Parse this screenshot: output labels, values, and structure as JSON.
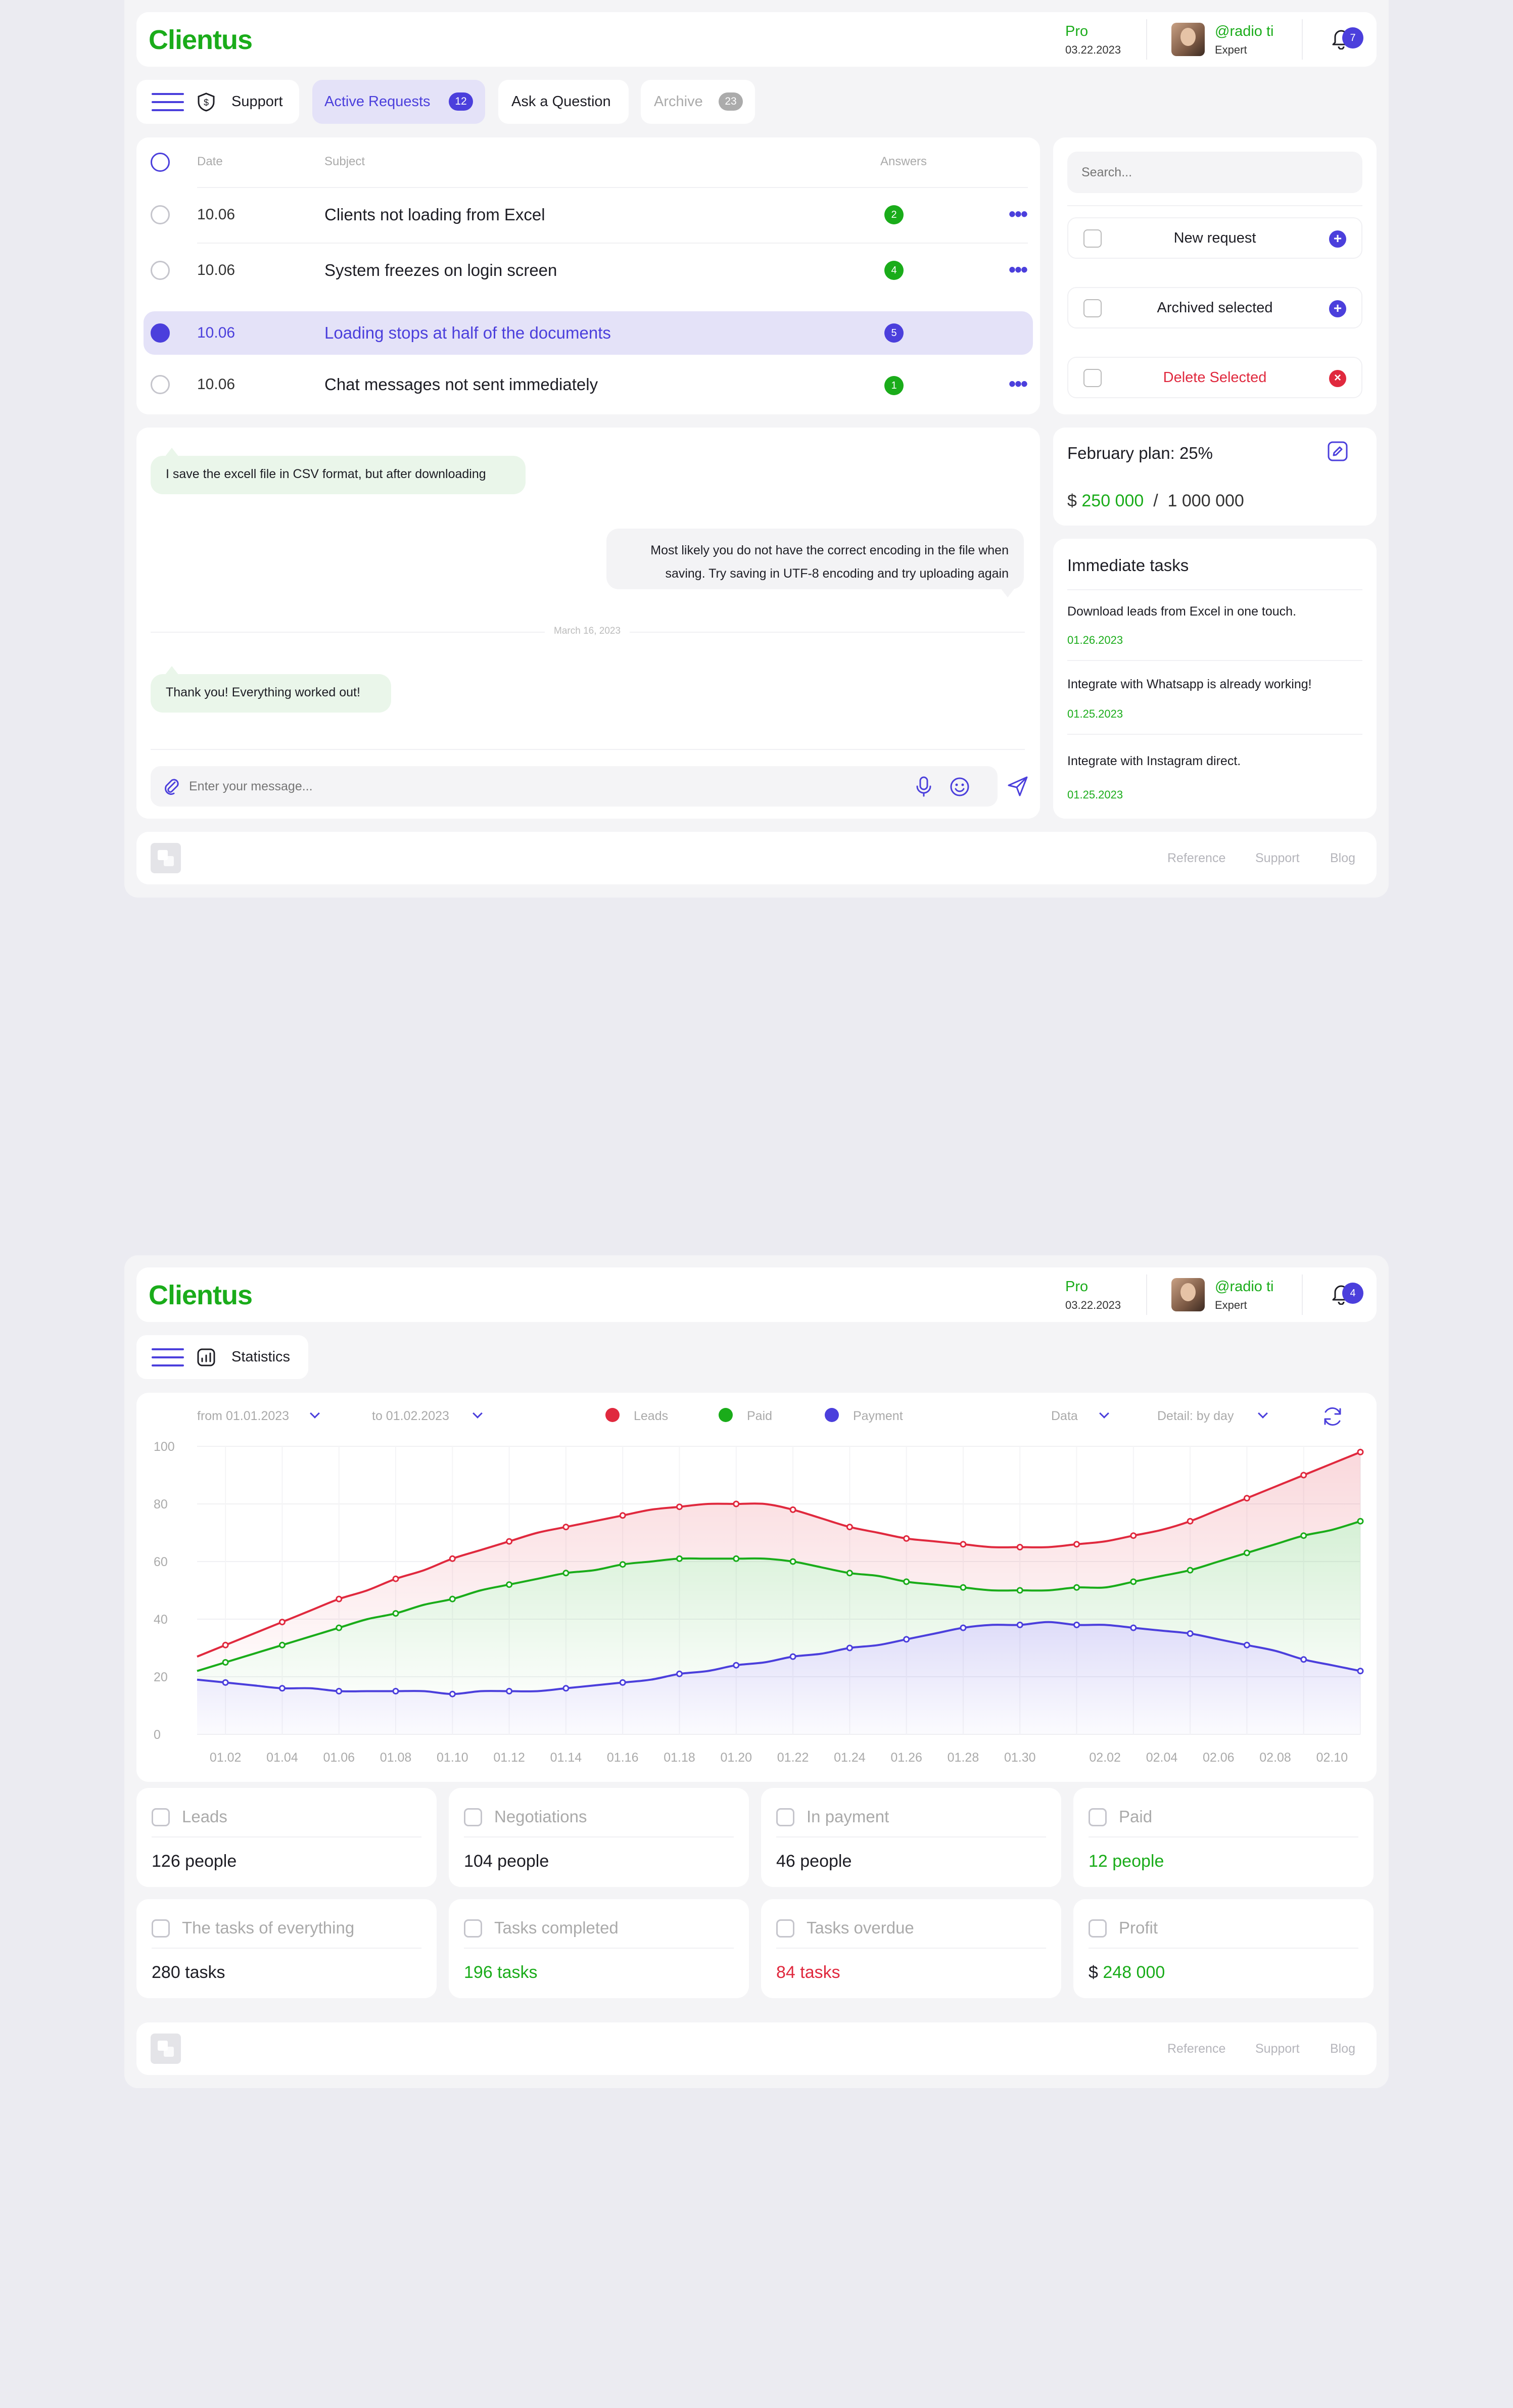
{
  "brand": {
    "name": "Clientus"
  },
  "header": {
    "plan": "Pro",
    "date": "03.22.2023",
    "username": "@radio ti",
    "role": "Expert",
    "notifications_screen1": "7",
    "notifications_screen2": "4"
  },
  "tabs": {
    "support": "Support",
    "active_requests": "Active Requests",
    "active_requests_count": "12",
    "ask_question": "Ask a Question",
    "archive": "Archive",
    "archive_count": "23",
    "statistics": "Statistics"
  },
  "requests": {
    "columns": {
      "date": "Date",
      "subject": "Subject",
      "answers": "Answers"
    },
    "rows": [
      {
        "date": "10.06",
        "subject": "Clients not loading from Excel",
        "answers": "2",
        "color": "#1aac1a"
      },
      {
        "date": "10.06",
        "subject": "System freezes on login screen",
        "answers": "4",
        "color": "#1aac1a"
      },
      {
        "date": "10.06",
        "subject": "Loading stops at half of the documents",
        "answers": "5",
        "color": "#4b3fdc"
      },
      {
        "date": "10.06",
        "subject": "Chat messages not sent immediately",
        "answers": "1",
        "color": "#1aac1a"
      }
    ]
  },
  "chat": {
    "msg1": "I save the excell file in CSV format, but after downloading",
    "msg2_line1": "Most likely you do not have the correct encoding in the file when",
    "msg2_line2": "saving. Try saving in UTF-8 encoding and try uploading again",
    "date_divider": "March 16, 2023",
    "msg3": "Thank you! Everything worked out!",
    "input_placeholder": "Enter your message..."
  },
  "sidebar": {
    "search_placeholder": "Search...",
    "new_request": "New request",
    "archived_selected": "Archived selected",
    "delete_selected": "Delete Selected"
  },
  "plan": {
    "title": "February plan: 25%",
    "currency": "$",
    "current": "250 000",
    "divider": "/",
    "target": "1 000 000",
    "fraction": 0.25
  },
  "tasks": {
    "title": "Immediate tasks",
    "items": [
      {
        "title": "Download leads from Excel in one touch.",
        "date": "01.26.2023"
      },
      {
        "title": "Integrate with Whatsapp is already working!",
        "date": "01.25.2023"
      },
      {
        "title": "Integrate with Instagram direct.",
        "date": "01.25.2023"
      }
    ]
  },
  "footer": {
    "reference": "Reference",
    "support": "Support",
    "blog": "Blog"
  },
  "filters": {
    "from": "from 01.01.2023",
    "to": "to 01.02.2023",
    "data": "Data",
    "detail": "Detail: by day"
  },
  "chart_data": {
    "type": "area",
    "ylim": [
      0,
      100
    ],
    "yticks": [
      0,
      20,
      40,
      60,
      80,
      100
    ],
    "x": [
      "01.01",
      "01.02",
      "01.03",
      "01.04",
      "01.05",
      "01.06",
      "01.07",
      "01.08",
      "01.09",
      "01.10",
      "01.11",
      "01.12",
      "01.13",
      "01.14",
      "01.15",
      "01.16",
      "01.17",
      "01.18",
      "01.19",
      "01.20",
      "01.21",
      "01.22",
      "01.23",
      "01.24",
      "01.25",
      "01.26",
      "01.27",
      "01.28",
      "01.29",
      "01.30",
      "01.31",
      "02.01",
      "02.02",
      "02.03",
      "02.04",
      "02.05",
      "02.06",
      "02.07",
      "02.08",
      "02.09",
      "02.10",
      "02.11"
    ],
    "xtick_labels": [
      "01.02",
      "01.04",
      "01.06",
      "01.08",
      "01.10",
      "01.12",
      "01.14",
      "01.16",
      "01.18",
      "01.20",
      "01.22",
      "01.24",
      "01.26",
      "01.28",
      "01.30",
      "02.02",
      "02.04",
      "02.06",
      "02.08",
      "02.10"
    ],
    "legend_position": "top-center",
    "grid": true,
    "series": [
      {
        "name": "Leads",
        "color": "#e0293e",
        "values": [
          27,
          31,
          35,
          39,
          43,
          47,
          50,
          54,
          57,
          61,
          64,
          67,
          70,
          72,
          74,
          76,
          78,
          79,
          80,
          80,
          80,
          78,
          75,
          72,
          70,
          68,
          67,
          66,
          65,
          65,
          65,
          66,
          67,
          69,
          71,
          74,
          78,
          82,
          86,
          90,
          94,
          98
        ]
      },
      {
        "name": "Paid",
        "color": "#1aac1a",
        "values": [
          22,
          25,
          28,
          31,
          34,
          37,
          40,
          42,
          45,
          47,
          50,
          52,
          54,
          56,
          57,
          59,
          60,
          61,
          61,
          61,
          61,
          60,
          58,
          56,
          55,
          53,
          52,
          51,
          50,
          50,
          50,
          51,
          51,
          53,
          55,
          57,
          60,
          63,
          66,
          69,
          71,
          74
        ]
      },
      {
        "name": "Payment",
        "color": "#4b3fdc",
        "values": [
          19,
          18,
          17,
          16,
          16,
          15,
          15,
          15,
          15,
          14,
          15,
          15,
          15,
          16,
          17,
          18,
          19,
          21,
          22,
          24,
          25,
          27,
          28,
          30,
          31,
          33,
          35,
          37,
          38,
          38,
          39,
          38,
          38,
          37,
          36,
          35,
          33,
          31,
          29,
          26,
          24,
          22
        ]
      }
    ]
  },
  "stats": [
    {
      "label": "Leads",
      "value": "126 people",
      "color": "#1d1d24"
    },
    {
      "label": "Negotiations",
      "value": "104 people",
      "color": "#1d1d24"
    },
    {
      "label": "In payment",
      "value": "46 people",
      "color": "#1d1d24"
    },
    {
      "label": "Paid",
      "value": "12 people",
      "color": "#1aac1a"
    },
    {
      "label": "The tasks of everything",
      "value": "280 tasks",
      "color": "#1d1d24"
    },
    {
      "label": "Tasks completed",
      "value": "196 tasks",
      "color": "#1aac1a"
    },
    {
      "label": "Tasks overdue",
      "value": "84 tasks",
      "color": "#e0293e"
    },
    {
      "label": "Profit",
      "value_currency": "$",
      "value": "248 000",
      "color": "#1aac1a"
    }
  ]
}
